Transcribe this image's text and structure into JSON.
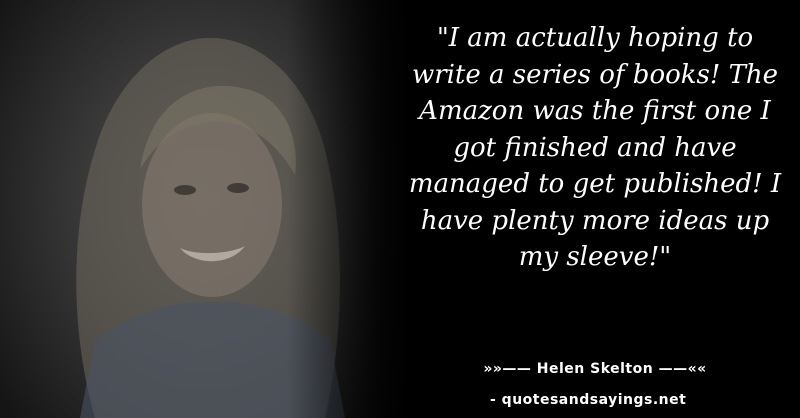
{
  "quote": {
    "text": "\"I am actually hoping to write a series of books! The Amazon was the first one I got finished and have managed to get published! I have plenty more ideas up my sleeve!\"",
    "attribution": "»»—— Helen Skelton ——««",
    "source": "- quotesandsayings.net"
  },
  "colors": {
    "background": "#000000",
    "text": "#ffffff"
  }
}
